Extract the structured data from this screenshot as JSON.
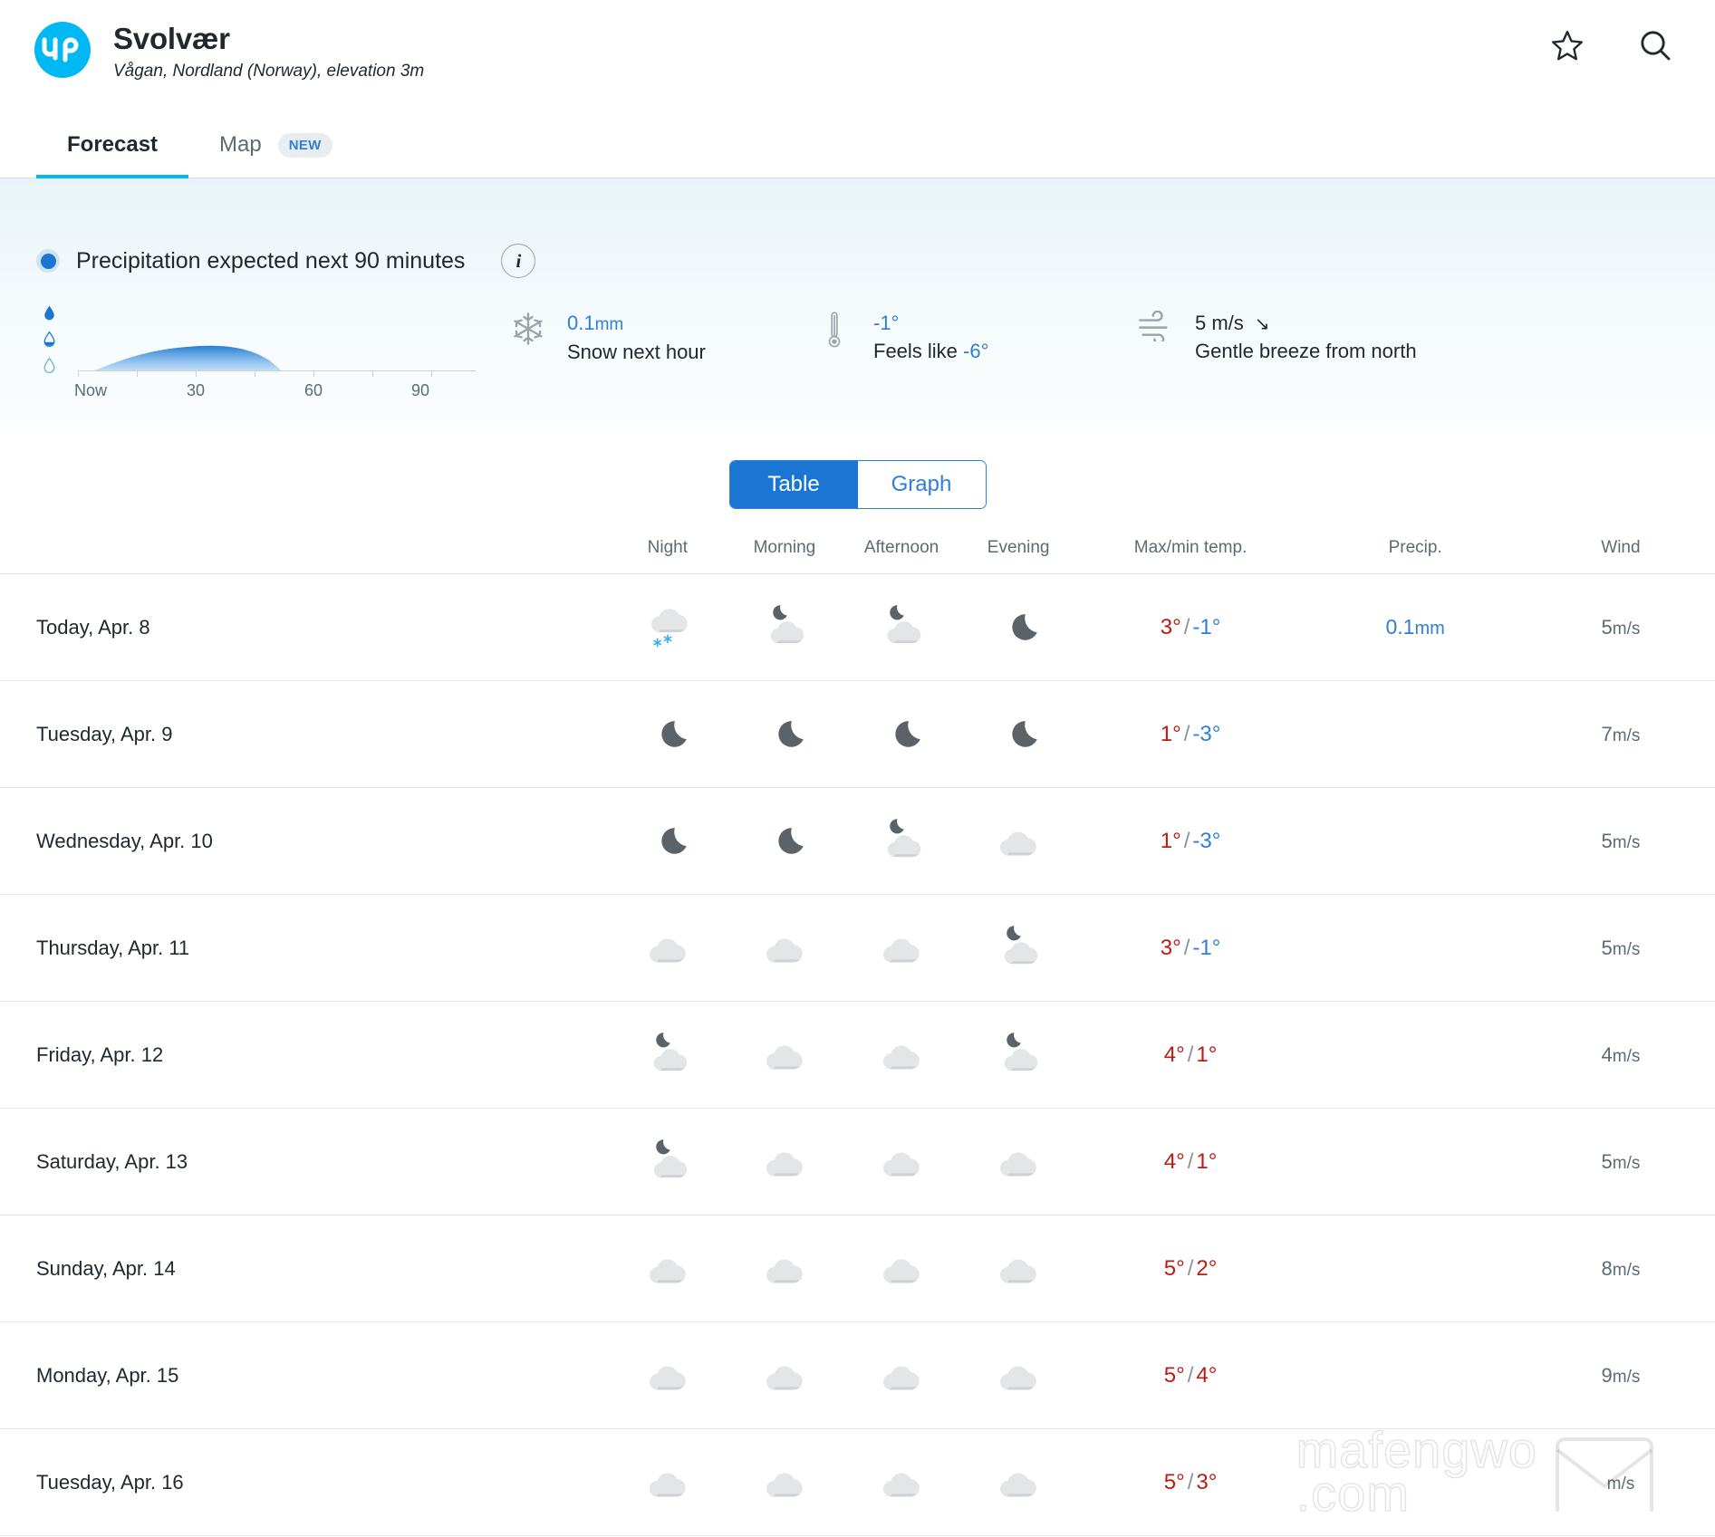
{
  "header": {
    "logo_text": "YR",
    "place_name": "Svolvær",
    "place_sub": "Vågan, Nordland (Norway), elevation 3m",
    "favorite_icon": "star-icon",
    "search_icon": "search-icon"
  },
  "tabs": [
    {
      "label": "Forecast",
      "active": true
    },
    {
      "label": "Map",
      "active": false,
      "badge": "NEW"
    }
  ],
  "nowcast": {
    "headline": "Precipitation expected next 90 minutes",
    "info_icon": "info-icon",
    "chart": {
      "axis_labels": [
        "Now",
        "30",
        "60",
        "90"
      ],
      "drop_icons": [
        "heavy-drop-icon",
        "medium-drop-icon",
        "light-drop-icon"
      ]
    },
    "stats": [
      {
        "icon": "snowflake-icon",
        "value": "0.1",
        "unit": "mm",
        "label": "Snow next hour"
      },
      {
        "icon": "thermometer-icon",
        "value": "-1°",
        "unit": "",
        "label_pre": "Feels like ",
        "label_value": "-6°"
      },
      {
        "icon": "wind-icon",
        "value": "5 m/s",
        "direction_arrow": "↘",
        "label": "Gentle breeze from north"
      }
    ]
  },
  "view_toggle": {
    "options": [
      "Table",
      "Graph"
    ],
    "selected": "Table"
  },
  "table": {
    "columns": [
      "",
      "Night",
      "Morning",
      "Afternoon",
      "Evening",
      "Max/min temp.",
      "Precip.",
      "Wind"
    ],
    "rows": [
      {
        "day": "Today, Apr. 8",
        "symbols": [
          "cloud-snow-icon",
          "moon-cloud-icon",
          "moon-cloud-icon",
          "moon-icon"
        ],
        "temp_max": "3°",
        "temp_min": "-1°",
        "min_sign": "cold",
        "precip": "0.1",
        "precip_unit": "mm",
        "wind": "5",
        "wind_unit": "m/s"
      },
      {
        "day": "Tuesday, Apr. 9",
        "symbols": [
          "moon-icon",
          "moon-icon",
          "moon-icon",
          "moon-icon"
        ],
        "temp_max": "1°",
        "temp_min": "-3°",
        "min_sign": "cold",
        "precip": "",
        "precip_unit": "",
        "wind": "7",
        "wind_unit": "m/s"
      },
      {
        "day": "Wednesday, Apr. 10",
        "symbols": [
          "moon-icon",
          "moon-icon",
          "moon-cloud-icon",
          "cloud-icon"
        ],
        "temp_max": "1°",
        "temp_min": "-3°",
        "min_sign": "cold",
        "precip": "",
        "precip_unit": "",
        "wind": "5",
        "wind_unit": "m/s"
      },
      {
        "day": "Thursday, Apr. 11",
        "symbols": [
          "cloud-icon",
          "cloud-icon",
          "cloud-icon",
          "moon-cloud-icon"
        ],
        "temp_max": "3°",
        "temp_min": "-1°",
        "min_sign": "cold",
        "precip": "",
        "precip_unit": "",
        "wind": "5",
        "wind_unit": "m/s"
      },
      {
        "day": "Friday, Apr. 12",
        "symbols": [
          "moon-cloud-icon",
          "cloud-icon",
          "cloud-icon",
          "moon-cloud-icon"
        ],
        "temp_max": "4°",
        "temp_min": "1°",
        "min_sign": "warm",
        "precip": "",
        "precip_unit": "",
        "wind": "4",
        "wind_unit": "m/s"
      },
      {
        "day": "Saturday, Apr. 13",
        "symbols": [
          "moon-cloud-icon",
          "cloud-icon",
          "cloud-icon",
          "cloud-icon"
        ],
        "temp_max": "4°",
        "temp_min": "1°",
        "min_sign": "warm",
        "precip": "",
        "precip_unit": "",
        "wind": "5",
        "wind_unit": "m/s"
      },
      {
        "day": "Sunday, Apr. 14",
        "symbols": [
          "cloud-icon",
          "cloud-icon",
          "cloud-icon",
          "cloud-icon"
        ],
        "temp_max": "5°",
        "temp_min": "2°",
        "min_sign": "warm",
        "precip": "",
        "precip_unit": "",
        "wind": "8",
        "wind_unit": "m/s"
      },
      {
        "day": "Monday, Apr. 15",
        "symbols": [
          "cloud-icon",
          "cloud-icon",
          "cloud-icon",
          "cloud-icon"
        ],
        "temp_max": "5°",
        "temp_min": "4°",
        "min_sign": "warm",
        "precip": "",
        "precip_unit": "",
        "wind": "9",
        "wind_unit": "m/s"
      },
      {
        "day": "Tuesday, Apr. 16",
        "symbols": [
          "cloud-icon",
          "cloud-icon",
          "cloud-icon",
          "cloud-icon"
        ],
        "temp_max": "5°",
        "temp_min": "3°",
        "min_sign": "warm",
        "precip": "",
        "precip_unit": "",
        "wind": "",
        "wind_unit": "m/s"
      }
    ]
  },
  "watermark": {
    "line1": "mafengwo",
    "line2": ".com"
  },
  "colors": {
    "brand": "#00b9f2",
    "accent_blue": "#1a76d2",
    "link_blue": "#2f7ed8",
    "temp_max_red": "#b91c14",
    "muted": "#5d6b72"
  },
  "chart_data": {
    "type": "area",
    "title": "Precipitation expected next 90 minutes",
    "xlabel": "",
    "ylabel": "",
    "x": [
      0,
      10,
      20,
      30,
      40,
      50,
      60,
      70,
      80,
      90
    ],
    "values": [
      0,
      0.05,
      0.1,
      0.09,
      0.04,
      0,
      0,
      0,
      0,
      0
    ],
    "tick_labels": [
      "Now",
      "30",
      "60",
      "90"
    ],
    "xlim": [
      0,
      90
    ],
    "ylim": [
      0,
      0.3
    ],
    "grid": false,
    "legend": "none",
    "series": [
      {
        "name": "Precipitation (mm)",
        "values": [
          0,
          0.05,
          0.1,
          0.09,
          0.04,
          0,
          0,
          0,
          0,
          0
        ]
      }
    ]
  }
}
